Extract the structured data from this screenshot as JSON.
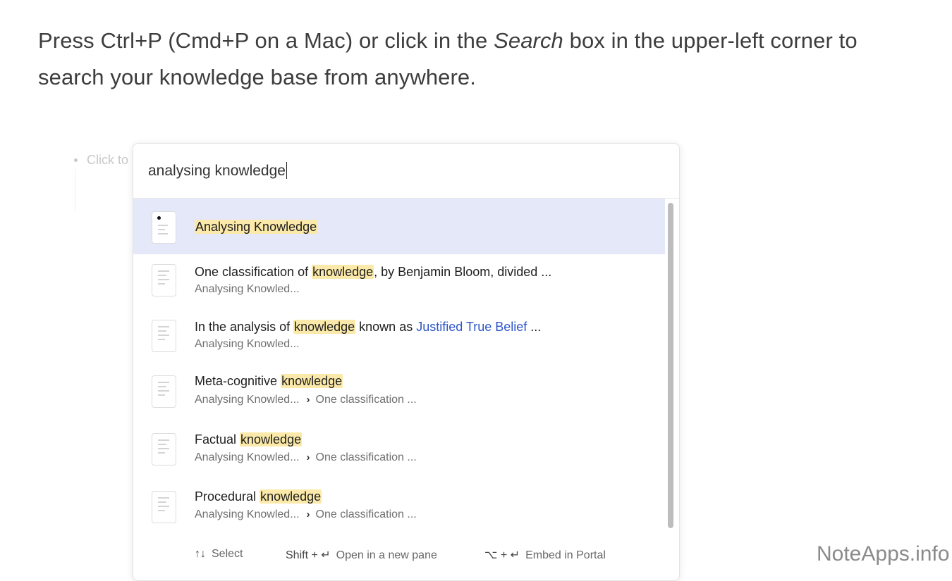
{
  "intro": {
    "before": "Press Ctrl+P (Cmd+P on a Mac) or click in the ",
    "emph": "Search",
    "after": " box in the upper-left corner to search your knowledge base from anywhere."
  },
  "background": {
    "bullet_text": "Click to"
  },
  "search": {
    "query": "analysing knowledge",
    "results": [
      {
        "pre": "",
        "hl": "Analysing Knowledge",
        "post": "",
        "link": "",
        "tail": "",
        "path": "",
        "path2": "",
        "selected": true,
        "icon": "page-icon"
      },
      {
        "pre": "One classification of ",
        "hl": "knowledge",
        "post": ", by Benjamin Bloom, divided  ...",
        "link": "",
        "tail": "",
        "path": "Analysing Knowled...",
        "path2": ""
      },
      {
        "pre": "In the analysis of ",
        "hl": "knowledge",
        "post": " known as ",
        "link": "Justified True Belief",
        "tail": " ...",
        "path": "Analysing Knowled...",
        "path2": ""
      },
      {
        "pre": "Meta-cognitive ",
        "hl": "knowledge",
        "post": "",
        "link": "",
        "tail": "",
        "path": "Analysing Knowled...",
        "path2": "One classification ..."
      },
      {
        "pre": "Factual ",
        "hl": "knowledge",
        "post": "",
        "link": "",
        "tail": "",
        "path": "Analysing Knowled...",
        "path2": "One classification ..."
      },
      {
        "pre": "Procedural ",
        "hl": "knowledge",
        "post": "",
        "link": "",
        "tail": "",
        "path": "Analysing Knowled...",
        "path2": "One classification ..."
      }
    ],
    "footer": {
      "select_keys": "↑↓",
      "select_label": "Select",
      "new_pane_keys": "Shift + ↵",
      "new_pane_label": "Open in a new pane",
      "embed_keys": "⌥ + ↵",
      "embed_label": "Embed in Portal"
    }
  },
  "watermark": "NoteApps.info",
  "colors": {
    "highlight": "#fbe9a9",
    "selected_row": "#e4e8f9",
    "link": "#2f55c9"
  }
}
